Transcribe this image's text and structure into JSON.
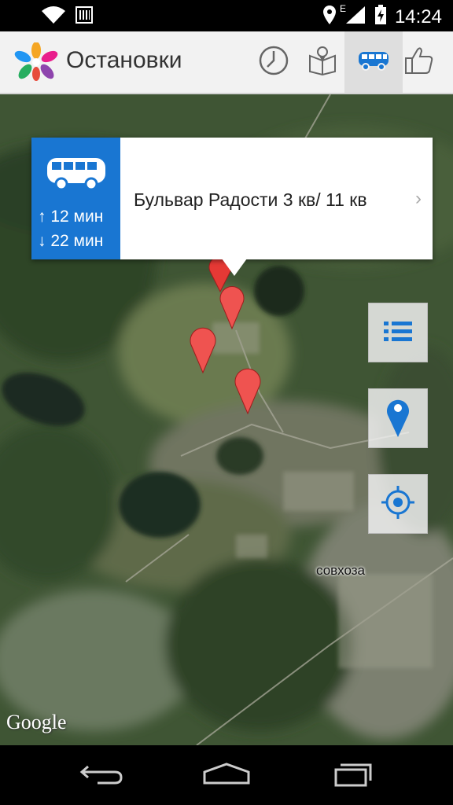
{
  "status_bar": {
    "time": "14:24",
    "left_icons": [
      "wifi-icon",
      "barcode-icon"
    ],
    "right_icons": [
      "location-icon",
      "signal-icon",
      "battery-charging-icon"
    ],
    "network_type": "E"
  },
  "action_bar": {
    "title": "Остановки",
    "tabs": [
      {
        "name": "clock-icon",
        "active": false
      },
      {
        "name": "map-book-icon",
        "active": false
      },
      {
        "name": "bus-icon",
        "active": true
      },
      {
        "name": "thumbs-up-icon",
        "active": false
      }
    ]
  },
  "callout": {
    "up_time": "↑ 12 мин",
    "down_time": "↓ 22 мин",
    "stop_name": "Бульвар Радости 3 кв/ 11 кв",
    "chevron": "›"
  },
  "map": {
    "poi_label": "совхоза",
    "attribution": "Google",
    "marker_color": "#e53935"
  },
  "side_buttons": [
    "list-icon",
    "map-pin-icon",
    "my-location-icon"
  ],
  "nav_bar": [
    "back-icon",
    "home-icon",
    "recents-icon"
  ],
  "colors": {
    "accent": "#1976d2",
    "action_bar_bg": "#f2f2f2"
  }
}
